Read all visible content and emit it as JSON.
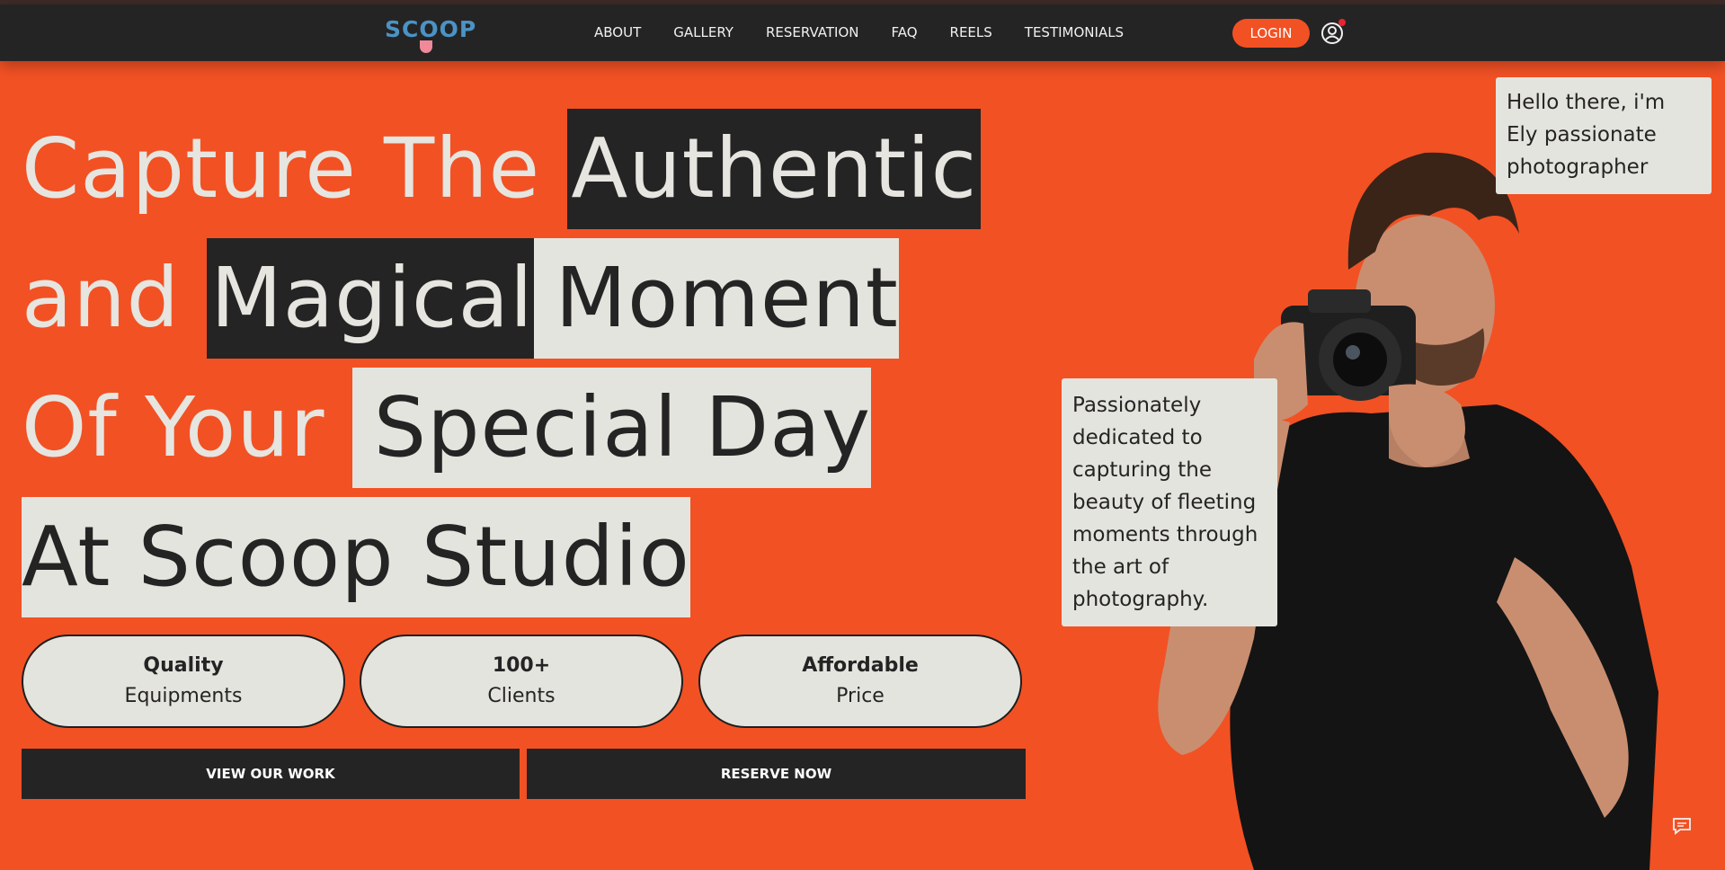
{
  "brand": {
    "logo_text": "SCOOP"
  },
  "nav": {
    "links": [
      "ABOUT",
      "GALLERY",
      "RESERVATION",
      "FAQ",
      "REELS",
      "TESTIMONIALS"
    ],
    "login_label": "LOGIN"
  },
  "hero": {
    "line1": {
      "plain": "Capture The ",
      "dark": "Authentic"
    },
    "line2": {
      "plain": "and ",
      "dark": "Magical",
      "light": "Moment"
    },
    "line3": {
      "plain": "Of Your ",
      "light": "Special Day"
    },
    "line4": {
      "light": "At Scoop Studio"
    }
  },
  "features": [
    {
      "top": "Quality",
      "bottom": "Equipments"
    },
    {
      "top": "100+",
      "bottom": "Clients"
    },
    {
      "top": "Affordable",
      "bottom": "Price"
    }
  ],
  "cta": {
    "primary": "VIEW OUR WORK",
    "secondary": "RESERVE NOW"
  },
  "bubbles": {
    "intro": "Hello there, i'm Ely passionate photographer",
    "bio": "Passionately dedicated to capturing the beauty of fleeting moments through the art of photography."
  },
  "icons": {
    "user": "user-icon",
    "chat": "chat-icon",
    "notification": "notification-dot"
  },
  "colors": {
    "accent": "#f25124",
    "dark": "#252424",
    "light": "#e4e4de"
  }
}
